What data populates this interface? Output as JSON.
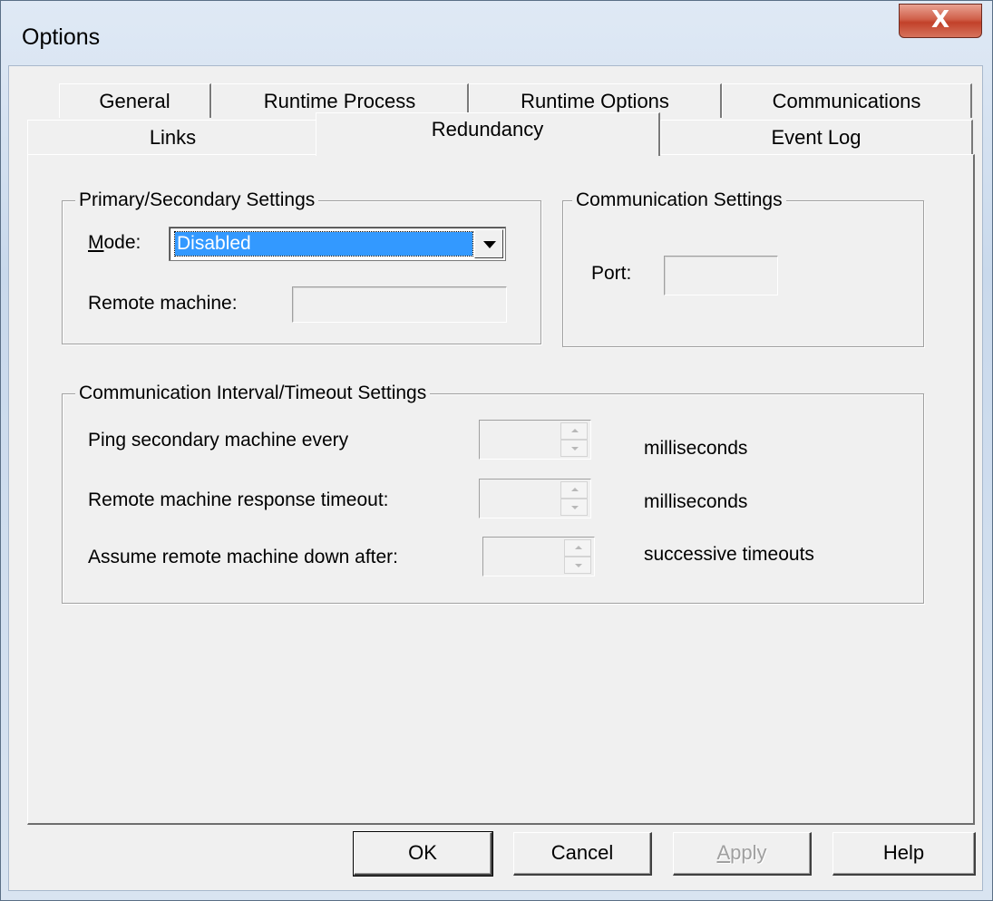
{
  "window": {
    "title": "Options",
    "close_glyph": "X"
  },
  "tabs_row1": [
    "General",
    "Runtime Process",
    "Runtime Options",
    "Communications"
  ],
  "tabs_row2": [
    "Links",
    "Redundancy",
    "Event Log"
  ],
  "active_tab": "Redundancy",
  "primary_secondary": {
    "legend": "Primary/Secondary Settings",
    "mode_label_first": "M",
    "mode_label_rest": "ode:",
    "mode_value": "Disabled",
    "remote_machine_label": "Remote machine:",
    "remote_machine_value": ""
  },
  "communication": {
    "legend": "Communication Settings",
    "port_label": "Port:",
    "port_value": ""
  },
  "interval": {
    "legend": "Communication Interval/Timeout Settings",
    "rows": [
      {
        "label": "Ping secondary machine every",
        "value": "",
        "unit": "milliseconds"
      },
      {
        "label": "Remote machine response timeout:",
        "value": "",
        "unit": "milliseconds"
      },
      {
        "label": "Assume remote machine down after:",
        "value": "",
        "unit": "successive timeouts"
      }
    ]
  },
  "buttons": {
    "ok": "OK",
    "cancel": "Cancel",
    "apply_first": "A",
    "apply_rest": "pply",
    "help": "Help"
  },
  "icons": {
    "dropdown": "chevron-down-icon",
    "spin_up": "spin-up-icon",
    "spin_down": "spin-down-icon"
  }
}
